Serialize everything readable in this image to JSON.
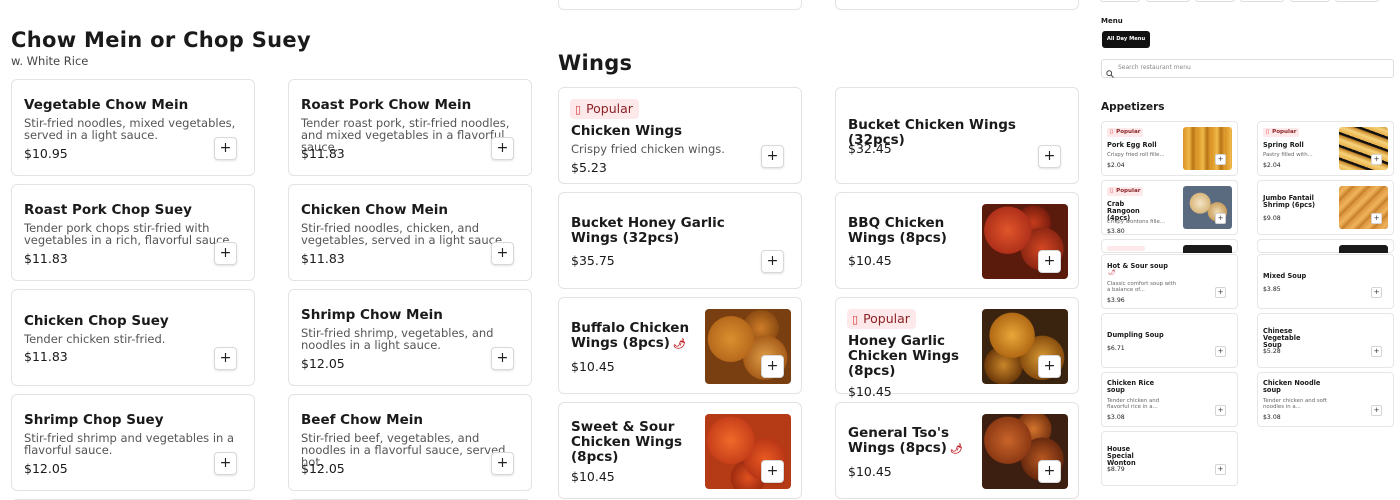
{
  "section_chow_mein": {
    "title": "Chow Mein or Chop Suey",
    "subtitle": "w. White Rice",
    "items": [
      {
        "name": "Vegetable Chow Mein",
        "desc": "Stir-fried noodles, mixed vegetables, served in a light sauce.",
        "price": "$10.95"
      },
      {
        "name": "Roast Pork Chow Mein",
        "desc": "Tender roast pork, stir-fried noodles, and mixed vegetables in a flavorful sauce.",
        "price": "$11.83"
      },
      {
        "name": "Roast Pork Chop Suey",
        "desc": "Tender pork chops stir-fried with vegetables in a rich, flavorful sauce.",
        "price": "$11.83"
      },
      {
        "name": "Chicken Chow Mein",
        "desc": "Stir-fried noodles, chicken, and vegetables, served in a light sauce.",
        "price": "$11.83"
      },
      {
        "name": "Chicken Chop Suey",
        "desc": "Tender chicken stir-fried.",
        "price": "$11.83"
      },
      {
        "name": "Shrimp Chow Mein",
        "desc": "Stir-fried shrimp, vegetables, and noodles in a light sauce.",
        "price": "$12.05"
      },
      {
        "name": "Shrimp Chop Suey",
        "desc": "Stir-fried shrimp and vegetables in a flavorful sauce.",
        "price": "$12.05"
      },
      {
        "name": "Beef Chow Mein",
        "desc": "Stir-fried beef, vegetables, and noodles in a flavorful sauce, served hot.",
        "price": "$12.05"
      }
    ]
  },
  "section_wings": {
    "title": "Wings",
    "popular_label": "Popular",
    "items": [
      {
        "name": "Chicken Wings",
        "desc": "Crispy fried chicken wings.",
        "price": "$5.23"
      },
      {
        "name": "Bucket Chicken Wings (32pcs)",
        "price": "$32.45"
      },
      {
        "name": "Bucket Honey Garlic Wings (32pcs)",
        "price": "$35.75"
      },
      {
        "name": "BBQ Chicken Wings (8pcs)",
        "price": "$10.45"
      },
      {
        "name": "Buffalo Chicken Wings (8pcs)",
        "price": "$10.45"
      },
      {
        "name": "Honey Garlic Chicken Wings (8pcs)",
        "price": "$10.45"
      },
      {
        "name": "Sweet & Sour Chicken Wings (8pcs)",
        "price": "$10.45"
      },
      {
        "name": "General Tso's Wings (8pcs)",
        "price": "$10.45"
      }
    ]
  },
  "sidebar": {
    "menu_label": "Menu",
    "menu_button": "All Day Menu",
    "search_placeholder": "Search restaurant menu",
    "section_title": "Appetizers",
    "popular_label": "Popular",
    "items": [
      {
        "name": "Pork Egg Roll",
        "desc": "Crispy fried roll fille...",
        "price": "$2.04"
      },
      {
        "name": "Spring Roll",
        "desc": "Pastry filled with...",
        "price": "$2.04"
      },
      {
        "name": "Crab Rangoon (4pcs)",
        "desc": "Crispy wontons fille...",
        "price": "$3.80"
      },
      {
        "name": "Jumbo Fantail Shrimp (6pcs)",
        "price": "$9.08"
      },
      {
        "name": "Hot & Sour soup",
        "desc": "Classic comfort soup with a balance of...",
        "price": "$3.96"
      },
      {
        "name": "Mixed Soup",
        "price": "$3.85"
      },
      {
        "name": "Dumpling Soup",
        "price": "$6.71"
      },
      {
        "name": "Chinese Vegetable Soup",
        "price": "$5.28"
      },
      {
        "name": "Chicken Rice soup",
        "desc": "Tender chicken and flavorful rice in a...",
        "price": "$3.08"
      },
      {
        "name": "Chicken Noodle soup",
        "desc": "Tender chicken and soft noodles in a...",
        "price": "$3.08"
      },
      {
        "name": "House Special Wonton",
        "price": "$8.79"
      }
    ]
  },
  "colors": {
    "popular_bg": "#fde9ea",
    "popular_text": "#8b2226",
    "chili": "#c0242b"
  }
}
